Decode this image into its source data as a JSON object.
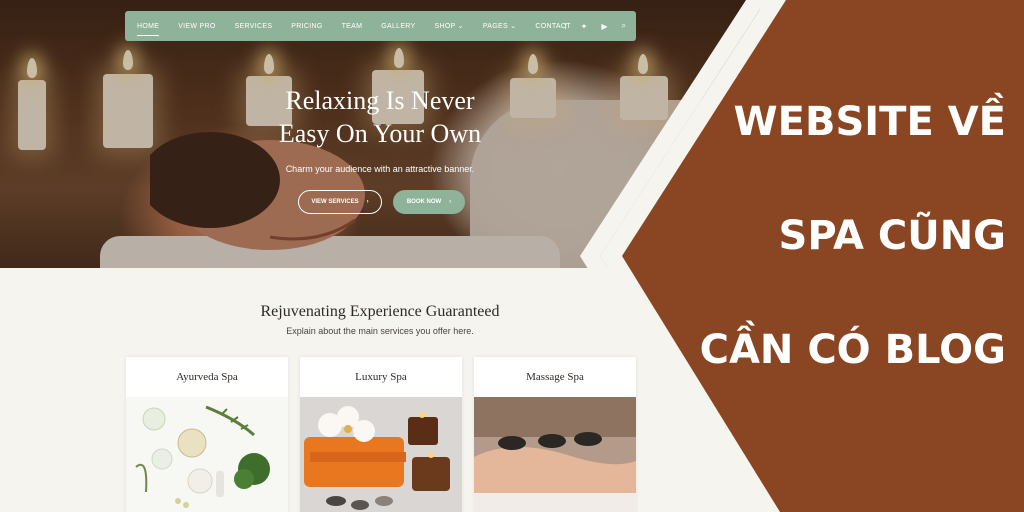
{
  "nav": {
    "items": [
      "HOME",
      "VIEW PRO",
      "SERVICES",
      "PRICING",
      "TEAM",
      "GALLERY",
      "SHOP ⌄",
      "PAGES ⌄",
      "CONTACT"
    ],
    "icons": [
      "facebook-icon",
      "twitter-icon",
      "youtube-icon",
      "search-icon"
    ]
  },
  "hero": {
    "title_line1": "Relaxing Is Never",
    "title_line2": "Easy On Your Own",
    "subtitle": "Charm your audience with an attractive banner.",
    "btn_view": "VIEW SERVICES",
    "btn_book": "BOOK NOW"
  },
  "section": {
    "title": "Rejuvenating Experience Guaranteed",
    "subtitle": "Explain about the main services you offer here."
  },
  "cards": [
    "Ayurveda Spa",
    "Luxury Spa",
    "Massage Spa"
  ],
  "banner": {
    "line1": "WEBSITE VỀ",
    "line2": "SPA CŨNG",
    "line3": "CẦN CÓ BLOG"
  },
  "colors": {
    "banner_brown": "#8a4522",
    "nav_green": "#8fb39a",
    "cream_stripe": "#f6f4ef"
  }
}
